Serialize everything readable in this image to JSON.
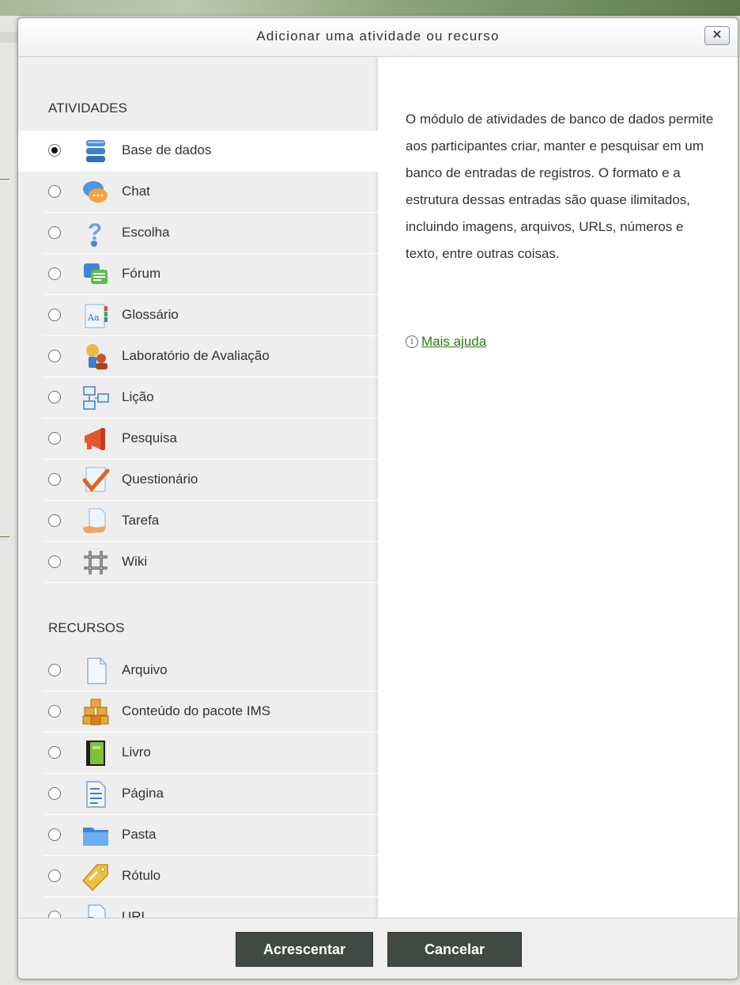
{
  "dialog": {
    "title": "Adicionar uma atividade ou recurso",
    "close_label": "✕"
  },
  "activities": {
    "heading": "ATIVIDADES",
    "items": [
      {
        "label": "Base de dados",
        "icon": "database-icon",
        "selected": true
      },
      {
        "label": "Chat",
        "icon": "chat-icon",
        "selected": false
      },
      {
        "label": "Escolha",
        "icon": "question-mark-icon",
        "selected": false
      },
      {
        "label": "Fórum",
        "icon": "forum-icon",
        "selected": false
      },
      {
        "label": "Glossário",
        "icon": "glossary-icon",
        "selected": false
      },
      {
        "label": "Laboratório de Avaliação",
        "icon": "workshop-icon",
        "selected": false
      },
      {
        "label": "Lição",
        "icon": "lesson-icon",
        "selected": false
      },
      {
        "label": "Pesquisa",
        "icon": "megaphone-icon",
        "selected": false
      },
      {
        "label": "Questionário",
        "icon": "quiz-checkmark-icon",
        "selected": false
      },
      {
        "label": "Tarefa",
        "icon": "assignment-icon",
        "selected": false
      },
      {
        "label": "Wiki",
        "icon": "wiki-icon",
        "selected": false
      }
    ]
  },
  "resources": {
    "heading": "RECURSOS",
    "items": [
      {
        "label": "Arquivo",
        "icon": "file-icon"
      },
      {
        "label": "Conteúdo do pacote IMS",
        "icon": "ims-package-icon"
      },
      {
        "label": "Livro",
        "icon": "book-icon"
      },
      {
        "label": "Página",
        "icon": "page-icon"
      },
      {
        "label": "Pasta",
        "icon": "folder-icon"
      },
      {
        "label": "Rótulo",
        "icon": "label-tag-icon"
      },
      {
        "label": "URL",
        "icon": "url-globe-icon"
      }
    ]
  },
  "description": {
    "text": "O módulo de atividades de banco de dados permite aos participantes criar, manter e pesquisar em um banco de entradas de registros. O formato e a estrutura dessas entradas são quase ilimitados, incluindo imagens, arquivos, URLs, números e texto, entre outras coisas.",
    "help_link": "Mais ajuda"
  },
  "footer": {
    "add_label": "Acrescentar",
    "cancel_label": "Cancelar"
  },
  "colors": {
    "button_bg": "#414a42",
    "link": "#2b7a15",
    "options_bg": "#eeeeee"
  }
}
